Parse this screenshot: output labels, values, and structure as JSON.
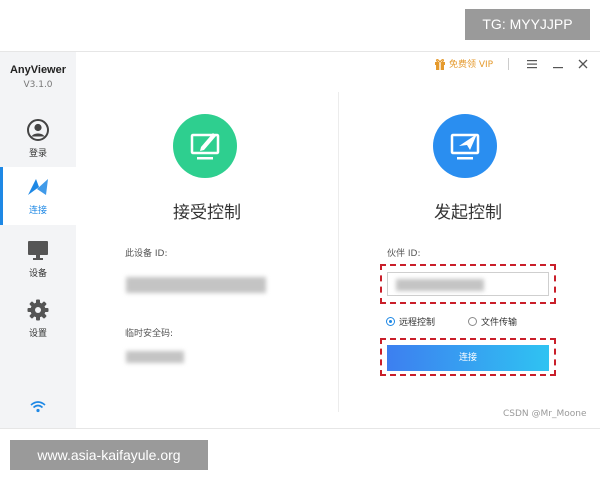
{
  "overlay": {
    "tg_text": "TG: MYYJJPP",
    "url_text": "www.asia-kaifayule.org",
    "csdn_text": "CSDN @Mr_Moone"
  },
  "app": {
    "name": "AnyViewer",
    "version": "V3.1.0"
  },
  "sidebar": {
    "items": [
      {
        "label": "登录",
        "icon": "user-icon"
      },
      {
        "label": "连接",
        "icon": "connect-icon",
        "active": true
      },
      {
        "label": "设备",
        "icon": "monitor-icon"
      },
      {
        "label": "设置",
        "icon": "gear-icon"
      }
    ],
    "status_icon": "wifi-icon"
  },
  "titlebar": {
    "vip_label": "免费领 VIP",
    "vip_icon": "gift-icon",
    "buttons": [
      "menu-icon",
      "minimize-icon",
      "close-icon"
    ]
  },
  "accept": {
    "title": "接受控制",
    "device_id_label": "此设备 ID:",
    "temp_code_label": "临时安全码:",
    "icon": "monitor-pen-icon"
  },
  "initiate": {
    "title": "发起控制",
    "partner_label": "伙伴 ID:",
    "radio_options": [
      "远程控制",
      "文件传输"
    ],
    "selected_option": "远程控制",
    "connect_label": "连接",
    "icon": "monitor-send-icon"
  },
  "colors": {
    "accent": "#1e88e5",
    "green": "#2ecf8f",
    "blue": "#2a8ef0",
    "highlight": "#c91f2a",
    "vip": "#e59a2d"
  }
}
